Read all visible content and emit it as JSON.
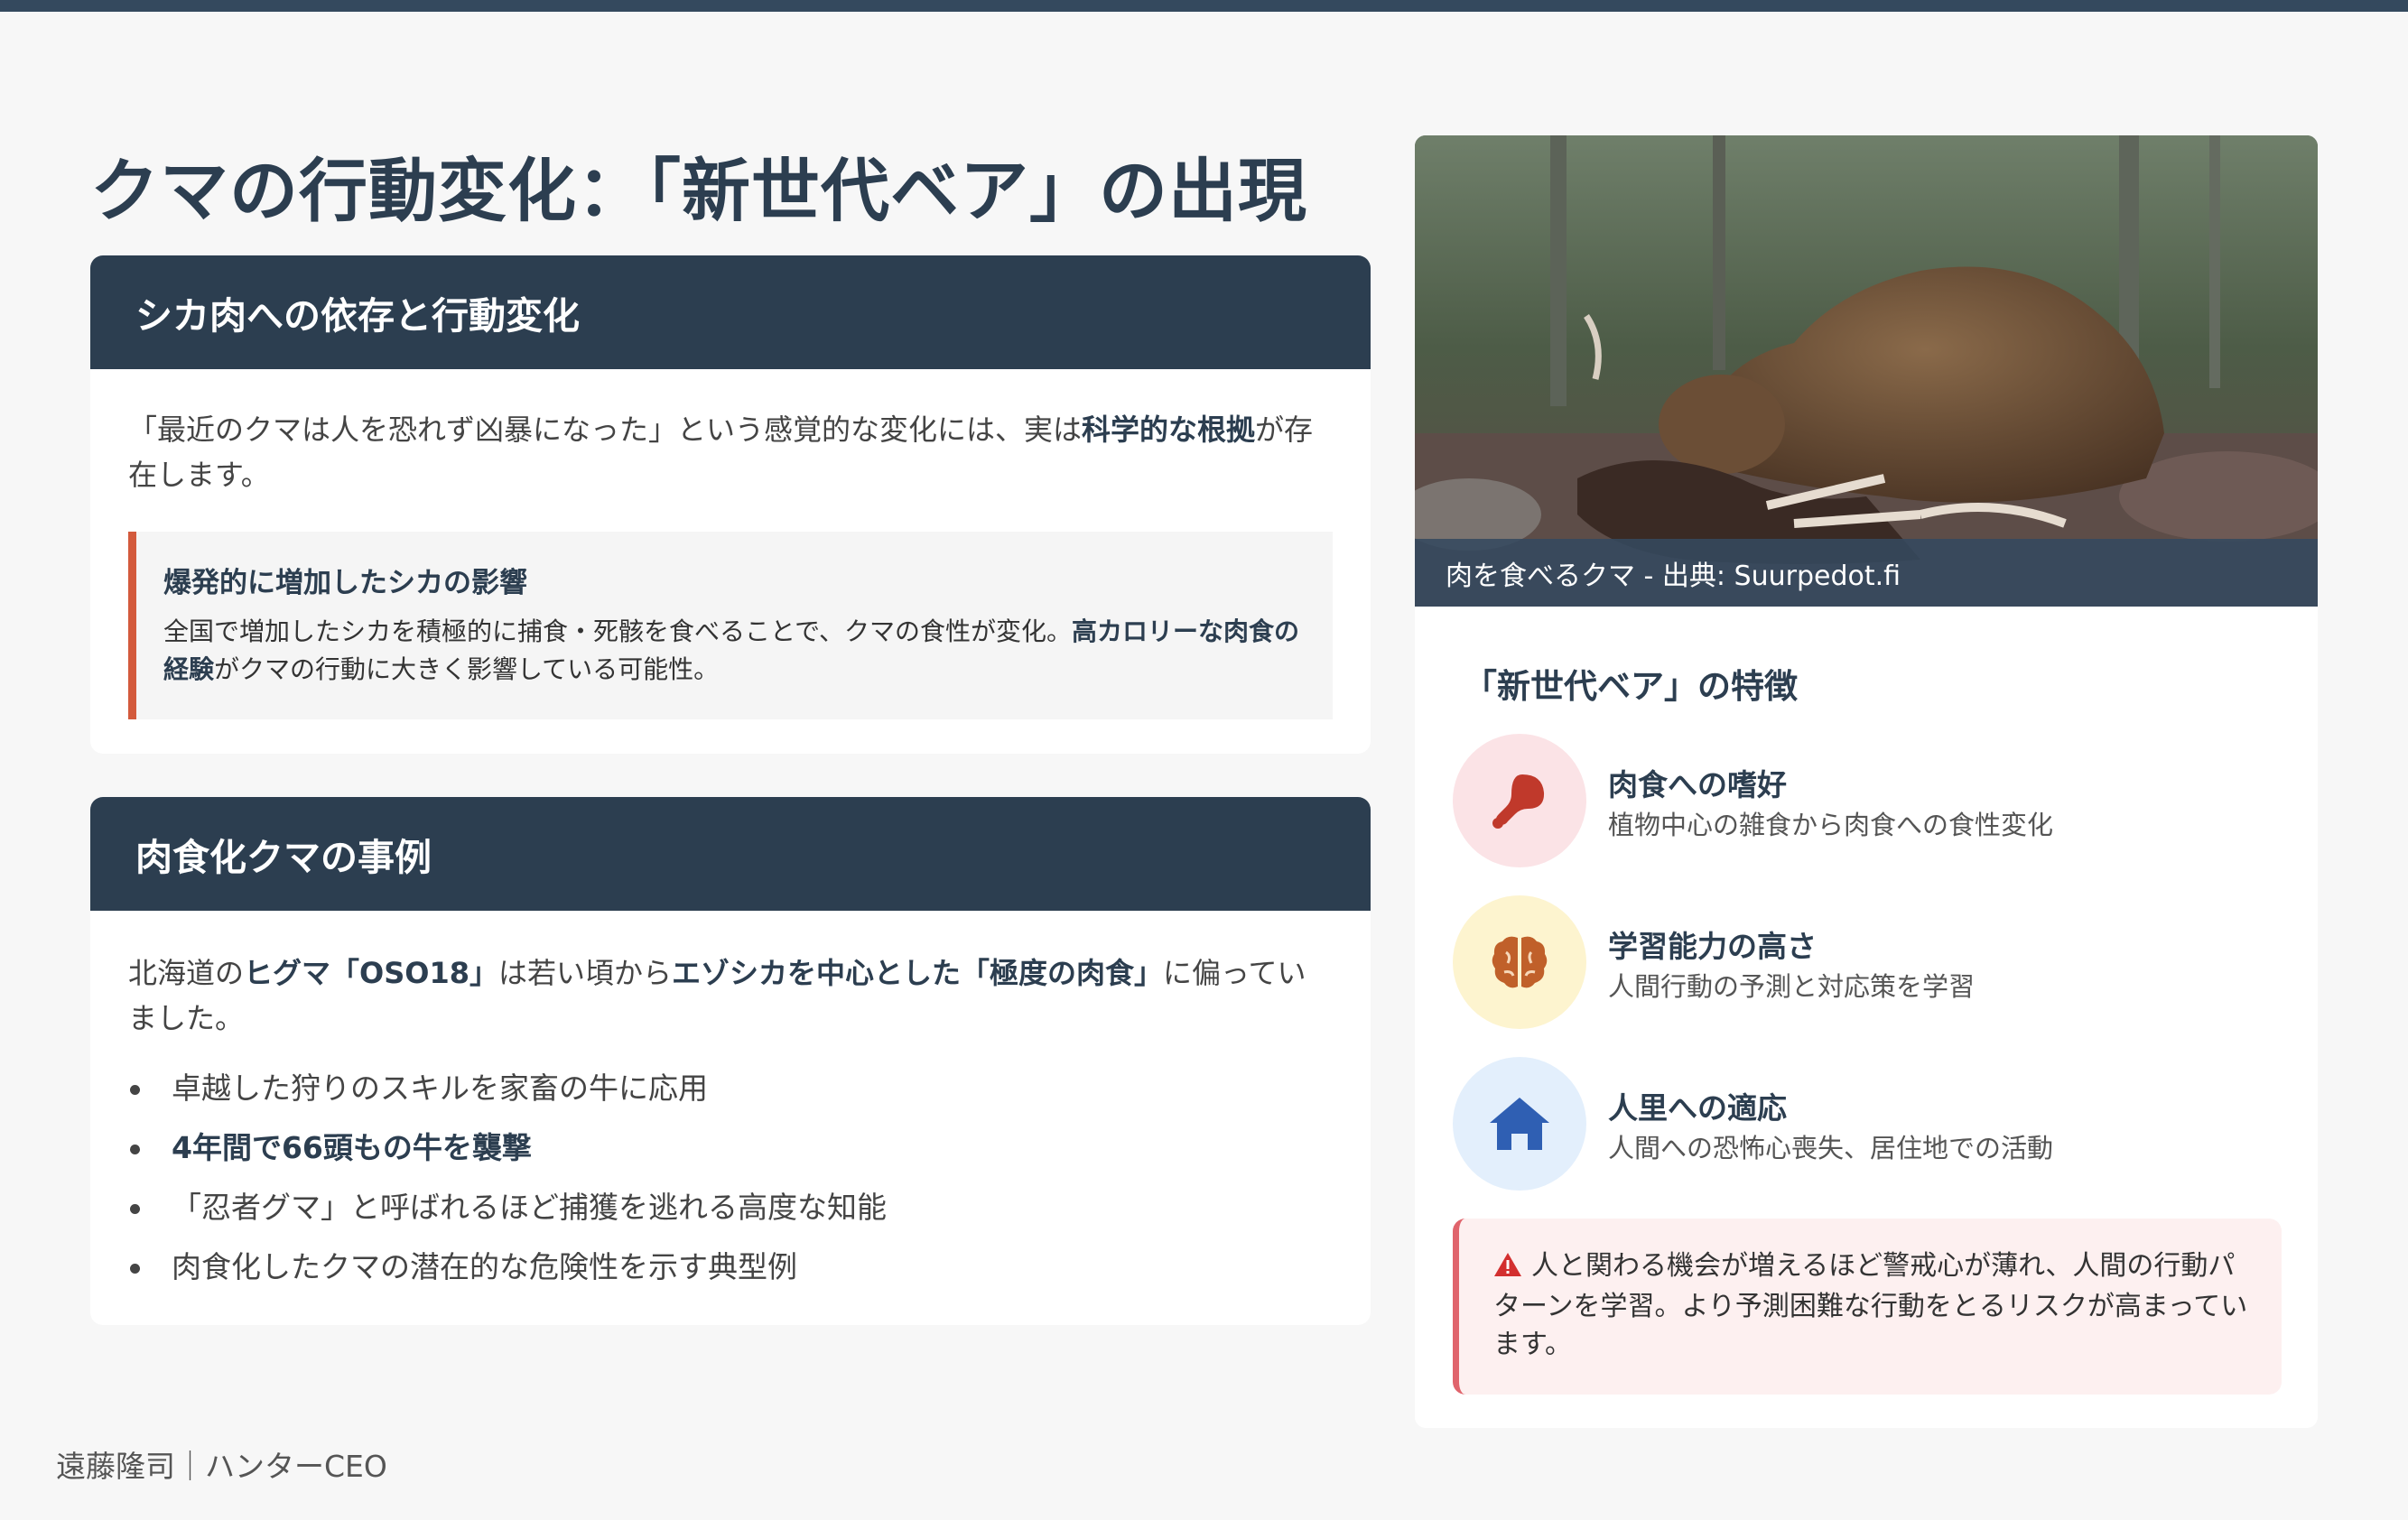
{
  "title": "クマの行動変化：「新世代ベア」の出現",
  "section1": {
    "header": "シカ肉への依存と行動変化",
    "intro_pre": "「最近のクマは人を恐れず凶暴になった」という感覚的な変化には、実は",
    "intro_bold": "科学的な根拠",
    "intro_post": "が存在します。",
    "callout": {
      "title": "爆発的に増加したシカの影響",
      "text_pre": "全国で増加したシカを積極的に捕食・死骸を食べることで、クマの食性が変化。",
      "text_bold": "高カロリーな肉食の経験",
      "text_post": "がクマの行動に大きく影響している可能性。"
    }
  },
  "section2": {
    "header": "肉食化クマの事例",
    "intro_pre": "北海道の",
    "intro_bold1": "ヒグマ「OSO18」",
    "intro_mid": "は若い頃から",
    "intro_bold2": "エゾシカを中心とした「極度の肉食」",
    "intro_post": "に偏っていました。",
    "bullets": [
      "卓越した狩りのスキルを家畜の牛に応用",
      "4年間で66頭もの牛を襲撃",
      "「忍者グマ」と呼ばれるほど捕獲を逃れる高度な知能",
      "肉食化したクマの潜在的な危険性を示す典型例"
    ]
  },
  "photo": {
    "caption": "肉を食べるクマ - 出典: Suurpedot.fi"
  },
  "features": {
    "title": "「新世代ベア」の特徴",
    "items": [
      {
        "title": "肉食への嗜好",
        "desc": "植物中心の雑食から肉食への食性変化",
        "icon": "meat-icon",
        "color": "#c0392b"
      },
      {
        "title": "学習能力の高さ",
        "desc": "人間行動の予測と対応策を学習",
        "icon": "brain-icon",
        "color": "#c0602a"
      },
      {
        "title": "人里への適応",
        "desc": "人間への恐怖心喪失、居住地での活動",
        "icon": "home-icon",
        "color": "#2f5fb3"
      }
    ]
  },
  "warning": {
    "text": "人と関わる機会が増えるほど警戒心が薄れ、人間の行動パターンを学習。より予測困難な行動をとるリスクが高まっています。"
  },
  "footer": "遠藤隆司｜ハンターCEO"
}
